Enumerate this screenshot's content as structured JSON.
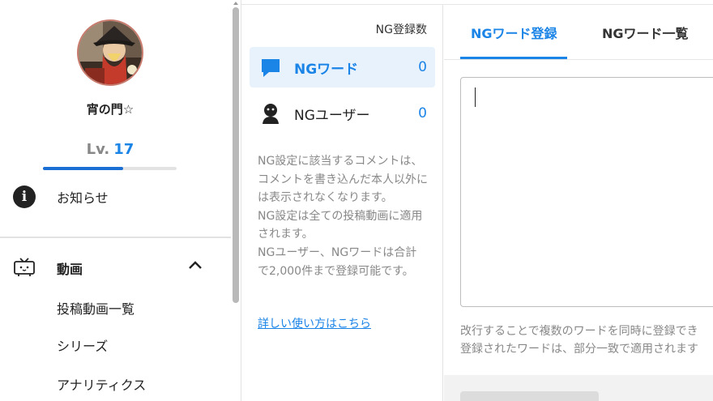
{
  "profile": {
    "username": "宵の門☆",
    "level_label": "Lv.",
    "level_value": "17",
    "level_progress": 0.6
  },
  "nav": {
    "notice": "お知らせ",
    "video_section": "動画",
    "video_items": [
      "投稿動画一覧",
      "シリーズ",
      "アナリティクス"
    ]
  },
  "ng_panel": {
    "count_header": "NG登録数",
    "rows": [
      {
        "label": "NGワード",
        "count": "0",
        "icon": "chat-bubble-icon"
      },
      {
        "label": "NGユーザー",
        "count": "0",
        "icon": "user-icon"
      }
    ],
    "description": [
      "NG設定に該当するコメントは、コメントを書き込んだ本人以外には表示されなくなります。",
      "NG設定は全ての投稿動画に適用されます。",
      "NGユーザー、NGワードは合計で2,000件まで登録可能です。"
    ],
    "help_link": "詳しい使い方はこちら"
  },
  "tabs": [
    "NGワード登録",
    "NGワード一覧"
  ],
  "hint_lines": [
    "改行することで複数のワードを同時に登録でき",
    "登録されたワードは、部分一致で適用されます"
  ],
  "colors": {
    "accent": "#1b84e7",
    "active_row_bg": "#e8f2fc"
  }
}
